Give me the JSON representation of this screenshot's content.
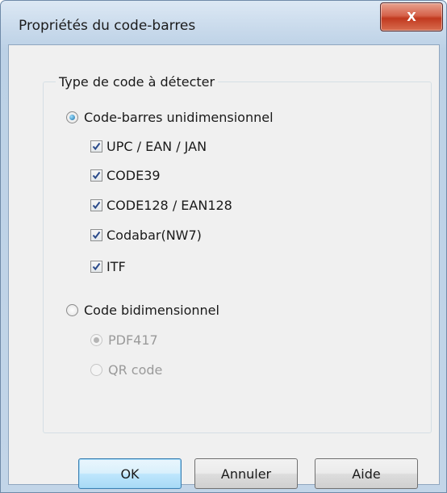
{
  "window": {
    "title": "Propriétés du code-barres",
    "close_icon_glyph": "X"
  },
  "group": {
    "title": "Type de code à détecter"
  },
  "radio_1d": {
    "label": "Code-barres unidimensionnel",
    "selected": true
  },
  "checkboxes": [
    {
      "label": "UPC / EAN / JAN",
      "checked": true
    },
    {
      "label": "CODE39",
      "checked": true
    },
    {
      "label": "CODE128 / EAN128",
      "checked": true
    },
    {
      "label": "Codabar(NW7)",
      "checked": true
    },
    {
      "label": "ITF",
      "checked": true
    }
  ],
  "radio_2d": {
    "label": "Code bidimensionnel",
    "selected": false
  },
  "sub_radios_2d": [
    {
      "label": "PDF417",
      "selected": true,
      "enabled": false
    },
    {
      "label": "QR code",
      "selected": false,
      "enabled": false
    }
  ],
  "buttons": {
    "ok": "OK",
    "cancel": "Annuler",
    "help": "Aide"
  },
  "colors": {
    "title_bar": "#c6d8ea",
    "close_button": "#c1391f",
    "dialog_background": "#f0f0f0",
    "default_button": "#bee6fd",
    "disabled_text": "#9a9a9a"
  }
}
